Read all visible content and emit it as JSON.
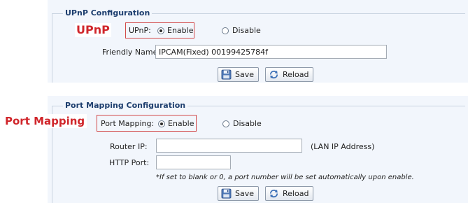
{
  "upnp": {
    "section_title": "UPnP Configuration",
    "callout": "UPnP",
    "mode_label": "UPnP:",
    "options": [
      {
        "label": "Enable",
        "checked": true
      },
      {
        "label": "Disable",
        "checked": false
      }
    ],
    "friendly_name_label": "Friendly Name:",
    "friendly_name_value": "IPCAM(Fixed) 00199425784f",
    "save_label": "Save",
    "reload_label": "Reload"
  },
  "port_mapping": {
    "section_title": "Port Mapping Configuration",
    "callout": "Port Mapping",
    "mode_label": "Port Mapping:",
    "options": [
      {
        "label": "Enable",
        "checked": true
      },
      {
        "label": "Disable",
        "checked": false
      }
    ],
    "router_ip_label": "Router IP:",
    "router_ip_value": "",
    "router_ip_hint": "(LAN IP Address)",
    "http_port_label": "HTTP Port:",
    "http_port_value": "",
    "note": "*If set to blank or 0, a port number will be set automatically upon enable.",
    "save_label": "Save",
    "reload_label": "Reload"
  },
  "colors": {
    "panel_bg": "#f2f6fc",
    "legend_text": "#1d3e6e",
    "callout_red": "#d0262b"
  },
  "icons": {
    "save": "floppy-disk-icon",
    "reload": "refresh-arrows-icon"
  }
}
